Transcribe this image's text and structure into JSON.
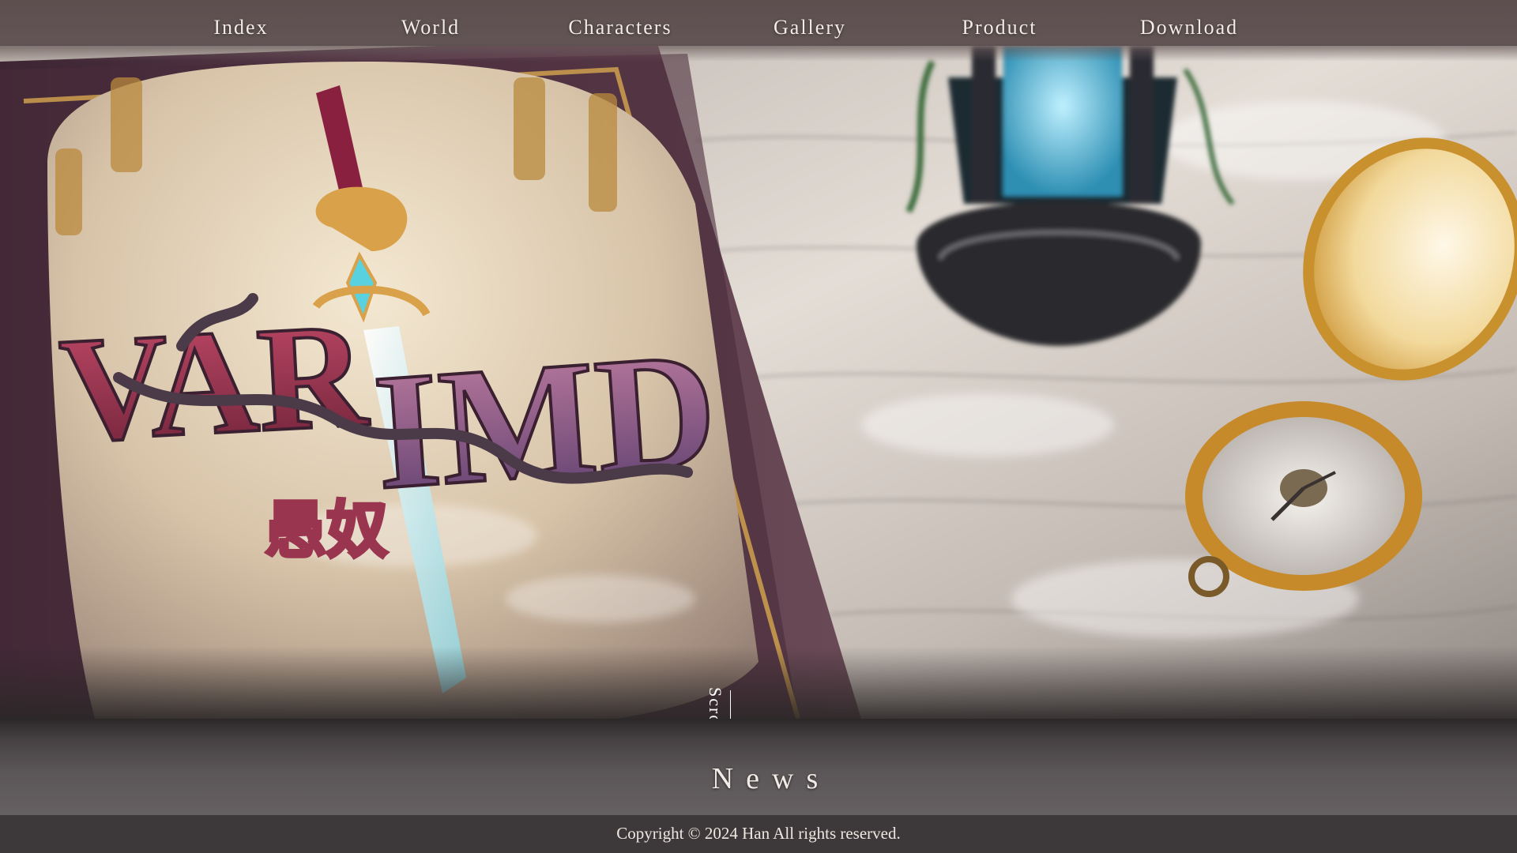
{
  "nav": {
    "items": [
      {
        "label": "Index"
      },
      {
        "label": "World"
      },
      {
        "label": "Characters"
      },
      {
        "label": "Gallery"
      },
      {
        "label": "Product"
      },
      {
        "label": "Download"
      }
    ]
  },
  "hero": {
    "logo_text": "VARI MD",
    "logo_subtitle": "愚奴",
    "scroll_label": "Scroll"
  },
  "news": {
    "title": "News"
  },
  "footer": {
    "copyright": "Copyright © 2024 Han All rights reserved."
  },
  "colors": {
    "nav_bg": "#6a5a5a",
    "nav_text": "#f3ece6",
    "book_frame": "#4a2c3a",
    "logo_crimson": "#a0304e",
    "logo_purple": "#6a4a78",
    "gold": "#d9a24a",
    "table_wood": "#d8d0c8",
    "news_bg": "#5b5657",
    "footer_bg": "#3d3839"
  },
  "icons": {
    "scroll": "down-arrow-line-icon",
    "sword": "sword-emblem-icon",
    "pocket_watch": "pocket-watch-icon",
    "lantern": "lantern-icon"
  }
}
